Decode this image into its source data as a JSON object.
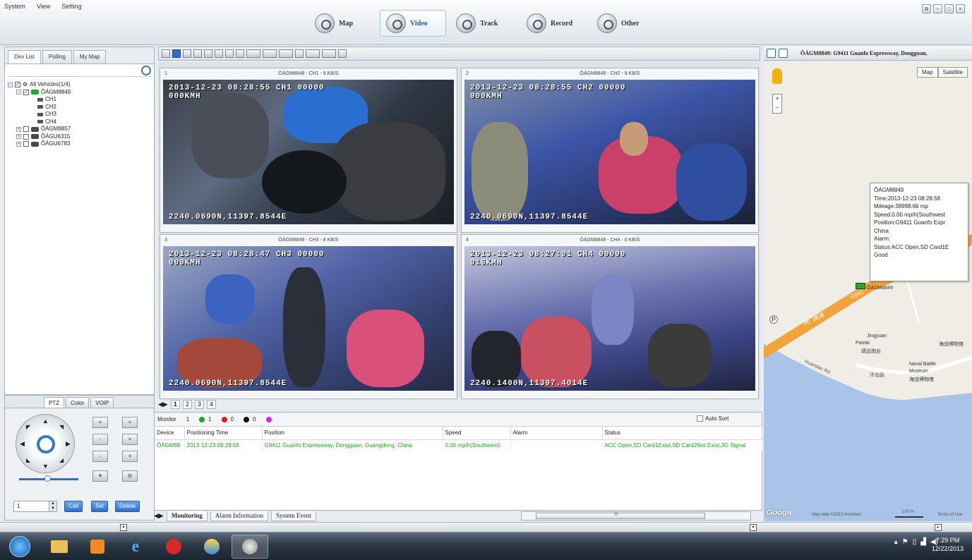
{
  "menu": {
    "items": [
      "System",
      "View",
      "Setting"
    ]
  },
  "nav_tabs": [
    {
      "label": "Map"
    },
    {
      "label": "Video",
      "active": true
    },
    {
      "label": "Track"
    },
    {
      "label": "Record"
    },
    {
      "label": "Other"
    }
  ],
  "left_tabs": {
    "dev_list": "Dev List",
    "polling": "Polling",
    "my_map": "My Map"
  },
  "search": {
    "value": ""
  },
  "tree": {
    "root": "All Vehicles(1/4)",
    "vehicles": [
      {
        "name": "ÔÁGM8849",
        "online": true,
        "channels": [
          "CH1",
          "CH2",
          "CH3",
          "CH4"
        ]
      },
      {
        "name": "ÔÁGM8857",
        "online": false
      },
      {
        "name": "ÔÁGU6315",
        "online": false
      },
      {
        "name": "ÔÁGU6783",
        "online": false
      }
    ]
  },
  "ptz": {
    "tabs": [
      "PTZ",
      "Color",
      "VOIP"
    ],
    "preset_value": "1",
    "call_label": "Call",
    "set_label": "Set",
    "delete_label": "Delete"
  },
  "video_cells": [
    {
      "num": "1",
      "title": "ÔÁGM8849 - CH1 - 9 KB/S",
      "osd_top": "2013-12-23 08:28:55    CH1 00000",
      "osd_speed": "000KMH",
      "osd_bottom": "2240.0690N,11397.8544E"
    },
    {
      "num": "2",
      "title": "ÔÁGM8849 - CH2 - 9 KB/S",
      "osd_top": "2013-12-23 08:28:55    CH2 00000",
      "osd_speed": "000KMH",
      "osd_bottom": "2240.0690N,11397.8544E"
    },
    {
      "num": "3",
      "title": "ÔÁGM8849 - CH3 - 8 KB/S",
      "osd_top": "2013-12-23 08:28:47    CH3 00000",
      "osd_speed": "000KMH",
      "osd_bottom": "2240.0690N,11397.8544E"
    },
    {
      "num": "4",
      "title": "ÔÁGM8849 - CH4 - 0 KB/S",
      "osd_top": "2013-12-23 08:27:01    CH4 00000",
      "osd_speed": "016KMH",
      "osd_bottom": "2240.1400N,11397.4014E"
    }
  ],
  "page_tabs": [
    "1",
    "2",
    "3",
    "4"
  ],
  "monitor": {
    "label": "Monitor",
    "total": "1",
    "green": "1",
    "red": "0",
    "black": "0",
    "magenta": "",
    "auto_sort": "Auto Sort",
    "colors": {
      "green": "#1fa61f",
      "red": "#e02020",
      "black": "#111111",
      "magenta": "#e020e0"
    },
    "columns": [
      "Device",
      "Positioning Time",
      "Position",
      "Speed",
      "Alarm",
      "Status"
    ],
    "rows": [
      [
        "ÔÁGM88",
        "2013-12-23 08:28:58",
        "G9411 Guanfo Expressway, Dongguan, Guangdong, China",
        "0.00 mp/h(Southwest)",
        "",
        "ACC Open,SD Card1Exist,SD Card2Not Exist,3G Signal"
      ]
    ]
  },
  "bottom_tabs": [
    "Monitoring",
    "Alarm Information",
    "System Event"
  ],
  "scroll_mark": "III",
  "map": {
    "header": "ÔÁGM8849: G9411 Guanfo Expressway, Dongguan,",
    "map_btn": "Map",
    "satellite_btn": "Satellite",
    "info": {
      "device": "ÔÁGM8849",
      "time": "Time:2013-12-23 08:28:58",
      "mileage": "Mileage:38998.66 mp",
      "speed": "Speed:0.00 mp/h(Southwest",
      "position": "Position:G9411 Guanfo Expr",
      "country": "China",
      "alarm": "Alarm:",
      "status": "Status:ACC Open,SD Card1E",
      "good": "Good"
    },
    "marker_label": "ÔÁGM8849",
    "labels": {
      "jingyuan": "Jingyuan",
      "paotai": "Paotai",
      "paotai_cn": "靖远炮台",
      "museum_cn1": "海战博物馆",
      "naval": "Naval Battle",
      "museum": "Museum",
      "museum_cn2": "海战博物馆",
      "huandao": "Huandao Rd",
      "huandao_cn": "环岛路",
      "road_cn": "虎门高速",
      "road_g": "G941",
      "poi_p": "P"
    },
    "google": "Google",
    "attribution": "Map data ©2013 AutoNavi",
    "scale": "100 m",
    "terms": "Terms of Use"
  },
  "clock": {
    "time": "7:29 PM",
    "date": "12/22/2013"
  }
}
